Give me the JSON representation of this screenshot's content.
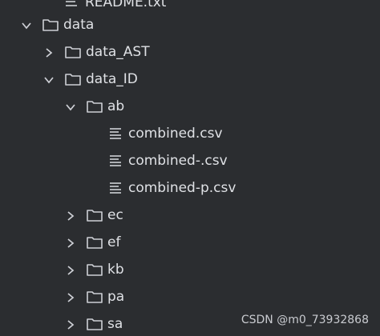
{
  "tree": {
    "readme": "README.txt",
    "data": "data",
    "data_ast": "data_AST",
    "data_id": "data_ID",
    "ab": "ab",
    "file_combined": "combined.csv",
    "file_combined_dash": "combined-.csv",
    "file_combined_p": "combined-p.csv",
    "ec": "ec",
    "ef": "ef",
    "kb": "kb",
    "pa": "pa",
    "sa": "sa"
  },
  "icons": {
    "folder": "folder-icon",
    "file": "text-file-icon",
    "expanded": "chevron-down-icon",
    "collapsed": "chevron-right-icon"
  },
  "colors": {
    "background": "#2b2d30",
    "text": "#dfe1e5",
    "icon": "#ced0d6"
  },
  "watermark": "CSDN @m0_73932868"
}
